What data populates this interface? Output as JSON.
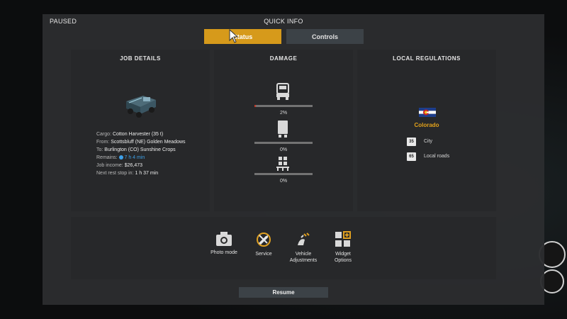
{
  "header": {
    "paused_label": "PAUSED",
    "title": "QUICK INFO"
  },
  "tabs": [
    {
      "label": "Status",
      "active": true
    },
    {
      "label": "Controls",
      "active": false
    }
  ],
  "job_details": {
    "title": "JOB DETAILS",
    "cargo_label": "Cargo:",
    "cargo_value": "Cotton Harvester (35 t)",
    "from_label": "From:",
    "from_value": "Scottsbluff (NE) Golden Meadows",
    "to_label": "To:",
    "to_value": "Burlington (CO) Sunshine Crops",
    "remains_label": "Remains:",
    "remains_value": "7 h 4 min",
    "income_label": "Job income:",
    "income_value": "$26,473",
    "rest_label": "Next rest stop in:",
    "rest_value": "1 h 37 min"
  },
  "damage": {
    "title": "DAMAGE",
    "items": [
      {
        "icon": "truck-icon",
        "percent_label": "2%",
        "value": 0.02
      },
      {
        "icon": "trailer-icon",
        "percent_label": "0%",
        "value": 0
      },
      {
        "icon": "cargo-icon",
        "percent_label": "0%",
        "value": 0
      }
    ]
  },
  "regulations": {
    "title": "LOCAL REGULATIONS",
    "state": "Colorado",
    "limits": [
      {
        "value": "35",
        "label": "City"
      },
      {
        "value": "65",
        "label": "Local roads"
      }
    ]
  },
  "actions": [
    {
      "icon": "camera-icon",
      "label": "Photo mode"
    },
    {
      "icon": "service-icon",
      "label": "Service"
    },
    {
      "icon": "vehicle-adjustments-icon",
      "label": "Vehicle\nAdjustments"
    },
    {
      "icon": "widget-options-icon",
      "label": "Widget\nOptions"
    }
  ],
  "resume_label": "Resume",
  "colors": {
    "accent": "#d69a1b",
    "state_text": "#e3a21a",
    "remains_blue": "#3ea0e8",
    "damage_red": "#c23b2b"
  }
}
